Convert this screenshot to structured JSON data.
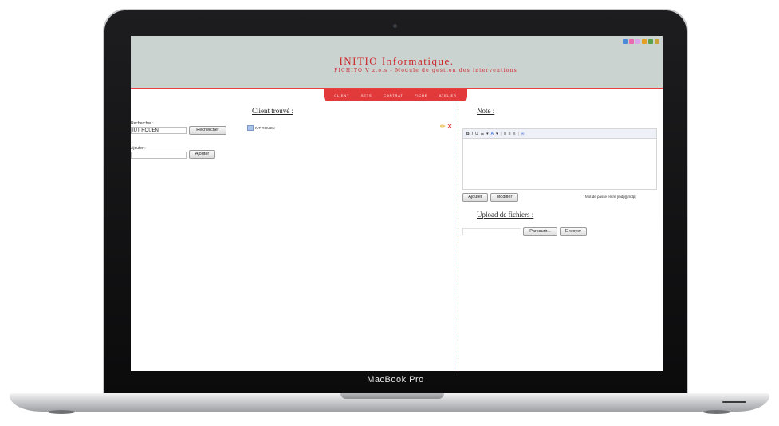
{
  "device": {
    "brand_label": "MacBook Pro"
  },
  "header": {
    "title": "INITIO Informatique.",
    "subtitle": "FICHITO V z.o.s - Module de gestion des interventions",
    "toolbar_icons": [
      "lang-icon",
      "mail-icon",
      "help-icon",
      "folder-icon",
      "user-icon",
      "home-icon"
    ]
  },
  "nav": {
    "items": [
      "CLIENT",
      "SETS",
      "CONTRAT",
      "FICHE",
      "ATELIER"
    ]
  },
  "search": {
    "search_label": "Rechercher :",
    "search_value": "IUT ROUEN",
    "search_button": "Rechercher",
    "add_label": "Ajouter :",
    "add_value": "",
    "add_button": "Ajouter"
  },
  "results": {
    "title": "Client trouvé :",
    "client_name": "IUT ROUEN",
    "edit_glyph": "✏",
    "delete_glyph": "✕"
  },
  "note": {
    "title": "Note :",
    "toolbar": [
      "B",
      "I",
      "U",
      "☰",
      "▾",
      "A",
      "▾",
      "|",
      "≡",
      "≡",
      "≡",
      "|",
      "∞"
    ],
    "add_button": "Ajouter",
    "modify_button": "Modifier",
    "password_hint": "Mot de passe entre [mdp][/mdp]"
  },
  "upload": {
    "title": "Upload de fichiers :",
    "browse_button": "Parcourir...",
    "send_button": "Envoyer"
  },
  "colors": {
    "accent_red": "#e23a3a",
    "header_bg": "#cbd3d1",
    "title_red": "#cc2a2a"
  }
}
